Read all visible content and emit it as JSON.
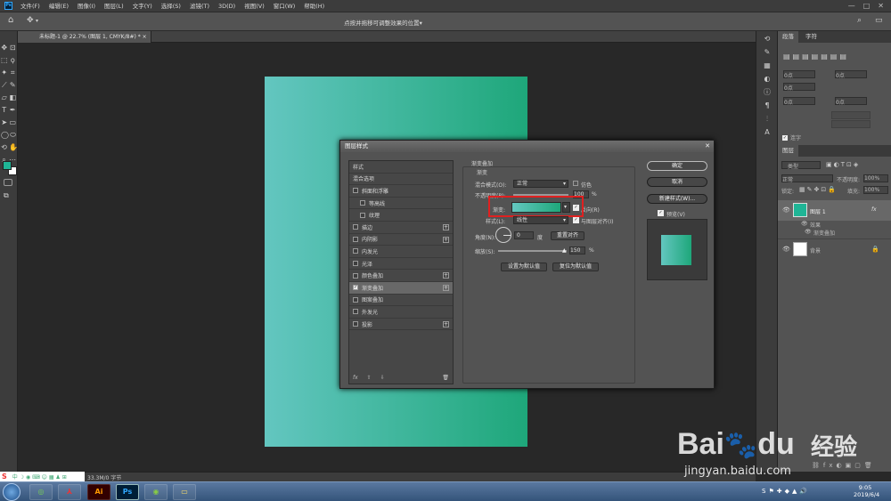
{
  "menubar": {
    "app_logo": "Ps",
    "items": [
      "文件(F)",
      "编辑(E)",
      "图像(I)",
      "图层(L)",
      "文字(Y)",
      "选择(S)",
      "滤镜(T)",
      "3D(D)",
      "视图(V)",
      "窗口(W)",
      "帮助(H)"
    ],
    "minimize_glyph": "—",
    "restore_glyph": "□",
    "close_glyph": "✕"
  },
  "optionsbar": {
    "hint": "点按并拖移可调整效果的位置"
  },
  "document": {
    "tab_label": "未标题-1 @ 22.7% (图层 1, CMYK/8#) *",
    "tab_close": "×"
  },
  "statusbar": {
    "text": "33.3M/0 字节"
  },
  "panels": {
    "tabs": [
      "段落",
      "字符"
    ],
    "hyphenate_label": "连字",
    "indent_values": [
      "0点",
      "0点",
      "0点",
      "0点",
      "0点"
    ],
    "layers_tab": "图层",
    "kind_filter": "类型",
    "blend_mode": "正常",
    "opacity_label": "不透明度:",
    "opacity_value": "100%",
    "lock_label": "锁定:",
    "fill_label": "填充:",
    "fill_value": "100%",
    "layers": [
      {
        "name": "图层 1",
        "fx": "fx"
      },
      {
        "name": "效果"
      },
      {
        "name": "渐变叠加"
      },
      {
        "name": "背景"
      }
    ]
  },
  "dialog": {
    "title": "图层样式",
    "close_glyph": "✕",
    "style_list": [
      {
        "label": "样式",
        "checkbox": false,
        "plus": false,
        "indent": false,
        "checked": false
      },
      {
        "label": "混合选项",
        "checkbox": false,
        "plus": false,
        "indent": false,
        "checked": false
      },
      {
        "label": "斜面和浮雕",
        "checkbox": true,
        "plus": false,
        "indent": false,
        "checked": false
      },
      {
        "label": "等高线",
        "checkbox": true,
        "plus": false,
        "indent": true,
        "checked": false
      },
      {
        "label": "纹理",
        "checkbox": true,
        "plus": false,
        "indent": true,
        "checked": false
      },
      {
        "label": "描边",
        "checkbox": true,
        "plus": true,
        "indent": false,
        "checked": false
      },
      {
        "label": "内阴影",
        "checkbox": true,
        "plus": true,
        "indent": false,
        "checked": false
      },
      {
        "label": "内发光",
        "checkbox": true,
        "plus": false,
        "indent": false,
        "checked": false
      },
      {
        "label": "光泽",
        "checkbox": true,
        "plus": false,
        "indent": false,
        "checked": false
      },
      {
        "label": "颜色叠加",
        "checkbox": true,
        "plus": true,
        "indent": false,
        "checked": false
      },
      {
        "label": "渐变叠加",
        "checkbox": true,
        "plus": true,
        "indent": false,
        "checked": true,
        "active": true
      },
      {
        "label": "图案叠加",
        "checkbox": true,
        "plus": false,
        "indent": false,
        "checked": false
      },
      {
        "label": "外发光",
        "checkbox": true,
        "plus": false,
        "indent": false,
        "checked": false
      },
      {
        "label": "投影",
        "checkbox": true,
        "plus": true,
        "indent": false,
        "checked": false
      }
    ],
    "list_footer": {
      "fx": "fx",
      "up": "⇧",
      "down": "⇩",
      "trash": "🗑"
    },
    "section_title": "渐变叠加",
    "subsection_title": "渐变",
    "blend_mode_label": "混合模式(O):",
    "blend_mode_value": "正常",
    "dither_label": "仿色",
    "opacity_label": "不透明度(P):",
    "opacity_value": "100",
    "opacity_unit": "%",
    "gradient_label": "渐变:",
    "reverse_label": "反向(R)",
    "style_label": "样式(L):",
    "style_value": "线性",
    "align_label": "与图层对齐(I)",
    "angle_label": "角度(N):",
    "angle_value": "0",
    "angle_unit": "度",
    "reset_align_button": "重置对齐",
    "scale_label": "缩放(S):",
    "scale_value": "150",
    "scale_unit": "%",
    "make_default_button": "设置为默认值",
    "reset_default_button": "复位为默认值",
    "ok_button": "确定",
    "cancel_button": "取消",
    "new_style_button": "新建样式(W)...",
    "preview_label": "预览(V)",
    "gradient_colors": [
      "#64c7c0",
      "#1ea77a"
    ]
  },
  "taskbar": {
    "apps": [
      "Ai",
      "Ps"
    ],
    "time": "9:05",
    "date": "2019/6/4"
  },
  "watermark": {
    "brand": "Bai",
    "brand2": "du",
    "brand_cn": "经验",
    "url": "jingyan.baidu.com"
  },
  "colors": {
    "foreground": "#1fb596",
    "background": "#ffffff",
    "highlight_box": "#e02020"
  }
}
